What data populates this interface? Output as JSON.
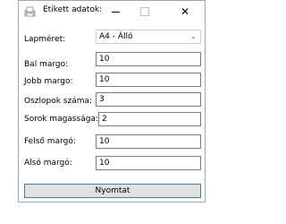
{
  "window": {
    "title": "Etikett adatok:",
    "controls": {
      "minimize": "minimize",
      "maximize": "maximize",
      "close": "✕"
    }
  },
  "form": {
    "paper_size": {
      "label": "Lapméret:",
      "value": "A4 - Álló"
    },
    "left_margin": {
      "label": "Bal margo:",
      "value": "10"
    },
    "right_margin": {
      "label": "Jobb margo:",
      "value": "10"
    },
    "columns": {
      "label": "Oszlopok száma:",
      "value": "3"
    },
    "row_height": {
      "label": "Sorok magassága:",
      "value": "2"
    },
    "top_margin": {
      "label": "Felső margó:",
      "value": "10"
    },
    "bottom_margin": {
      "label": "Alsó margó:",
      "value": "10"
    }
  },
  "actions": {
    "print_label": "Nyomtat"
  },
  "colors": {
    "button_border": "#3c7fb1",
    "button_bg": "#e1e1e1"
  }
}
